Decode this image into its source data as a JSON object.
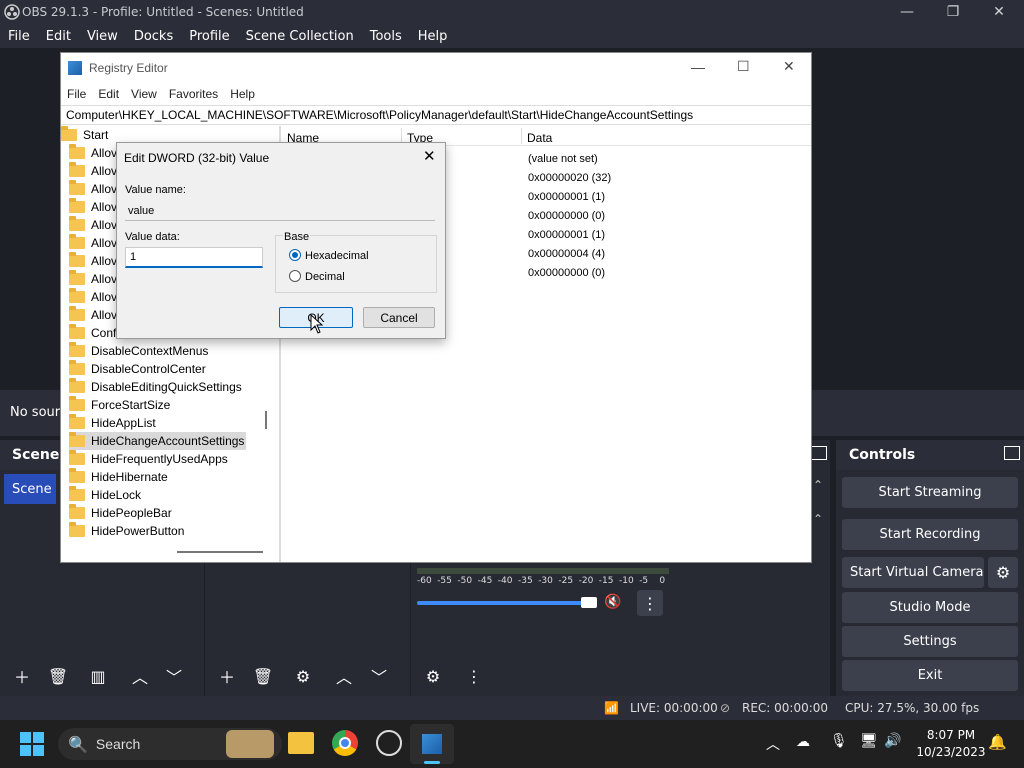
{
  "obs": {
    "window_title": "OBS 29.1.3 - Profile: Untitled - Scenes: Untitled",
    "menu": [
      "File",
      "Edit",
      "View",
      "Docks",
      "Profile",
      "Scene Collection",
      "Tools",
      "Help"
    ],
    "no_source_text": "No sourc",
    "scenes_header": "Scenes",
    "scene_item": "Scene",
    "controls_header": "Controls",
    "controls": {
      "start_streaming": "Start Streaming",
      "start_recording": "Start Recording",
      "start_virtual_camera": "Start Virtual Camera",
      "studio_mode": "Studio Mode",
      "settings": "Settings",
      "exit": "Exit"
    },
    "meter_ticks": [
      "-60",
      "-55",
      "-50",
      "-45",
      "-40",
      "-35",
      "-30",
      "-25",
      "-20",
      "-15",
      "-10",
      "-5",
      "0"
    ],
    "status": {
      "live": "LIVE: 00:00:00",
      "rec": "REC: 00:00:00",
      "cpu": "CPU: 27.5%, 30.00 fps"
    }
  },
  "registry": {
    "title": "Registry Editor",
    "menu": [
      "File",
      "Edit",
      "View",
      "Favorites",
      "Help"
    ],
    "address": "Computer\\HKEY_LOCAL_MACHINE\\SOFTWARE\\Microsoft\\PolicyManager\\default\\Start\\HideChangeAccountSettings",
    "tree_root": "Start",
    "tree": [
      "Allov",
      "Allov",
      "Allov",
      "Allov",
      "Allov",
      "Allov",
      "Allov",
      "Allov",
      "Allov",
      "Allov",
      "Conf",
      "DisableContextMenus",
      "DisableControlCenter",
      "DisableEditingQuickSettings",
      "ForceStartSize",
      "HideAppList",
      "HideChangeAccountSettings",
      "HideFrequentlyUsedApps",
      "HideHibernate",
      "HideLock",
      "HidePeopleBar",
      "HidePowerButton"
    ],
    "columns": {
      "name": "Name",
      "type": "Type",
      "data": "Data"
    },
    "rows": [
      {
        "type": "z",
        "data": "(value not set)"
      },
      {
        "type": "WORD",
        "data": "0x00000020 (32)"
      },
      {
        "type": "WORD",
        "data": "0x00000001 (1)"
      },
      {
        "type": "WORD",
        "data": "0x00000000 (0)"
      },
      {
        "type": "WORD",
        "data": "0x00000001 (1)"
      },
      {
        "type": "WORD",
        "data": "0x00000004 (4)"
      },
      {
        "type": "WORD",
        "data": "0x00000000 (0)"
      }
    ]
  },
  "dialog": {
    "title": "Edit DWORD (32-bit) Value",
    "value_name_label": "Value name:",
    "value_name": "value",
    "value_data_label": "Value data:",
    "value_data": "1",
    "base_label": "Base",
    "hex_label": "Hexadecimal",
    "dec_label": "Decimal",
    "ok": "OK",
    "cancel": "Cancel"
  },
  "taskbar": {
    "search": "Search",
    "time": "8:07 PM",
    "date": "10/23/2023"
  }
}
